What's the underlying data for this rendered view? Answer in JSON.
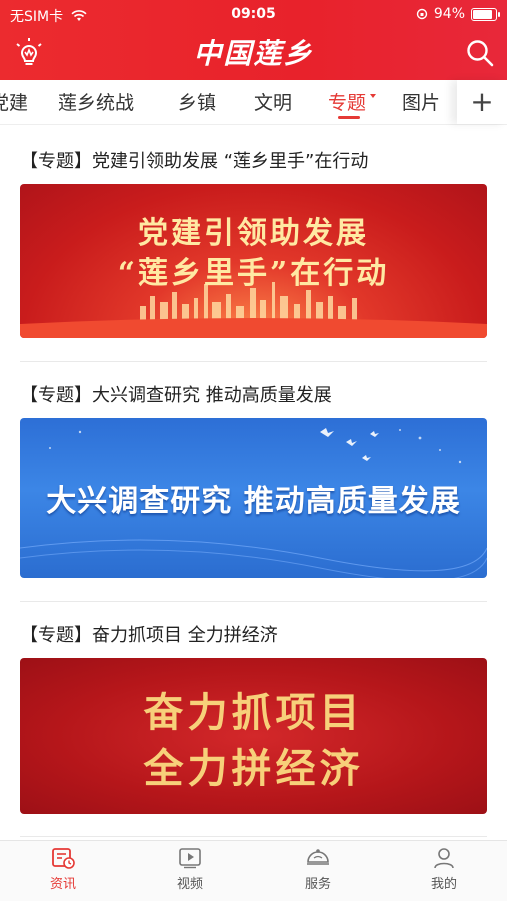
{
  "status_bar": {
    "carrier": "无SIM卡",
    "time": "09:05",
    "battery_percent": "94%",
    "battery_level": 0.94
  },
  "header": {
    "logo_text": "中国莲乡",
    "left_icon": "lightbulb-icon",
    "right_icon": "search-icon"
  },
  "tabs": {
    "items": [
      {
        "label": "党建"
      },
      {
        "label": "莲乡统战"
      },
      {
        "label": "乡镇"
      },
      {
        "label": "文明"
      },
      {
        "label": "专题"
      },
      {
        "label": "图片"
      }
    ],
    "active_index": 4,
    "add_label": "+"
  },
  "feed": [
    {
      "title": "【专题】党建引领助发展 “莲乡里手”在行动",
      "banner_lines": [
        "党建引领助发展",
        "“莲乡里手”在行动"
      ]
    },
    {
      "title": "【专题】大兴调查研究 推动高质量发展",
      "banner_lines": [
        "大兴调查研究 推动高质量发展"
      ]
    },
    {
      "title": "【专题】奋力抓项目 全力拼经济",
      "banner_lines": [
        "奋力抓项目",
        "全力拼经济"
      ]
    }
  ],
  "bottom_nav": [
    {
      "label": "资讯",
      "icon": "news-icon",
      "active": true
    },
    {
      "label": "视频",
      "icon": "video-icon",
      "active": false
    },
    {
      "label": "服务",
      "icon": "service-icon",
      "active": false
    },
    {
      "label": "我的",
      "icon": "profile-icon",
      "active": false
    }
  ],
  "colors": {
    "brand_red": "#e53935",
    "header_red": "#e8222b"
  }
}
